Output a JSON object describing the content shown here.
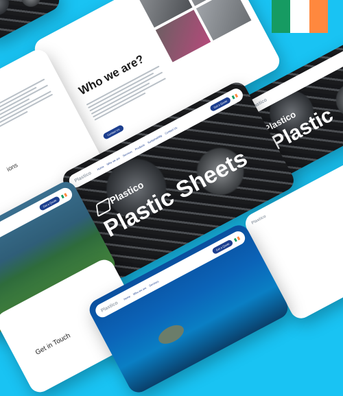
{
  "brand": {
    "name": "Plastico",
    "nav_links": [
      "Home",
      "Who we are",
      "Services",
      "Products",
      "Sustainability",
      "Contact Us"
    ],
    "cta_label": "Get a Quote",
    "flag_colors": [
      "#169b62",
      "#ffffff",
      "#ff883e"
    ]
  },
  "cards": {
    "about": {
      "heading": "Who we are?",
      "button": "Contact Us"
    },
    "hero_main": {
      "brand": "Plastico",
      "title": "Plastic Sheets"
    },
    "hero_right": {
      "brand": "Plastico",
      "title": "Plastic"
    },
    "left_text": {
      "partial_heading": "ions"
    },
    "coast": {
      "cta": "Get a Quote"
    },
    "contact": {
      "heading": "Get in Touch"
    },
    "ocean": {
      "cta": "Get a Quote"
    }
  }
}
